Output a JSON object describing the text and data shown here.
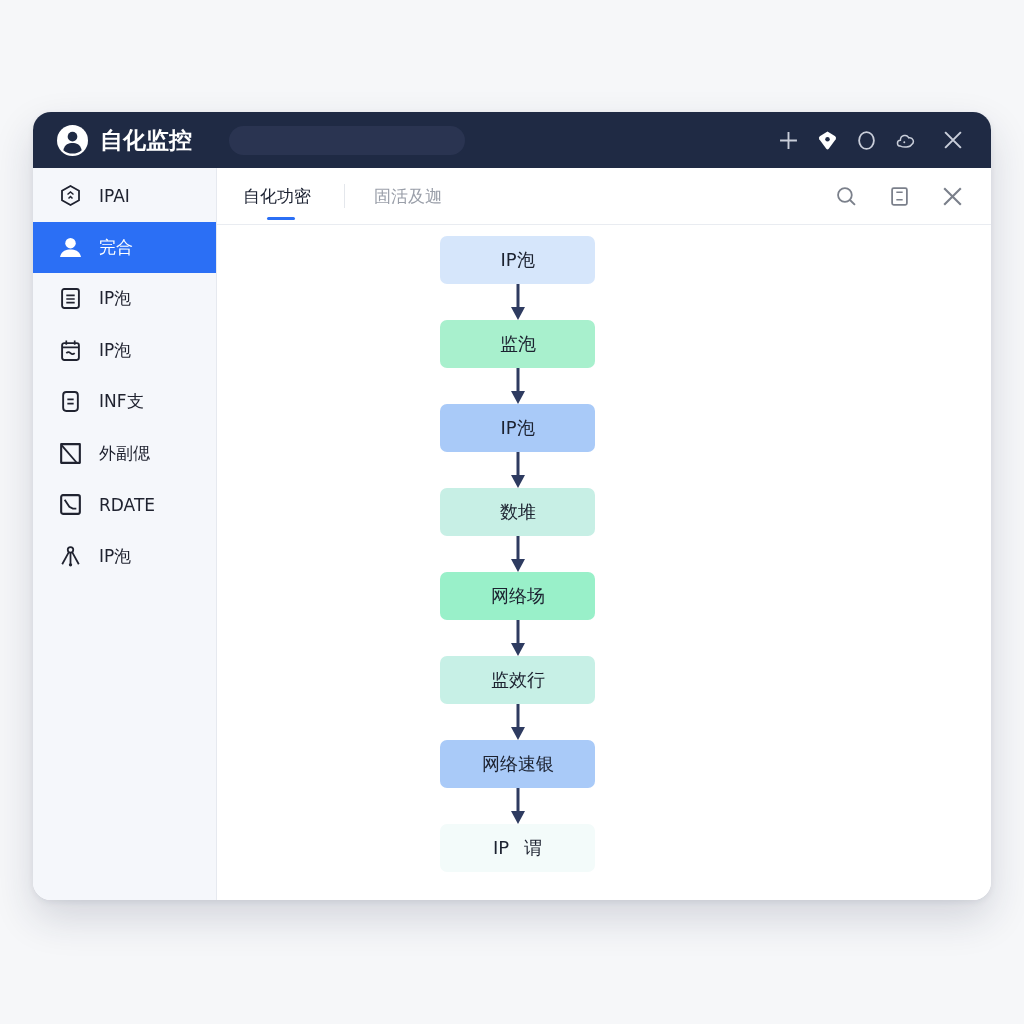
{
  "window": {
    "title": "自化监控"
  },
  "sidebar": {
    "items": [
      {
        "label": "IPAI",
        "selected": false
      },
      {
        "label": "完合",
        "selected": true
      },
      {
        "label": "IP泡",
        "selected": false
      },
      {
        "label": "IP泡",
        "selected": false
      },
      {
        "label": "INF支",
        "selected": false
      },
      {
        "label": "外副偲",
        "selected": false
      },
      {
        "label": "RDATE",
        "selected": false
      },
      {
        "label": "IP泡",
        "selected": false
      }
    ]
  },
  "tabs": [
    {
      "label": "自化功密",
      "selected": true
    },
    {
      "label": "固活及迦",
      "selected": false
    }
  ],
  "flow": {
    "nodes": [
      {
        "label": "IP泡",
        "color": "#d6e6fb"
      },
      {
        "label": "监泡",
        "color": "#a8f0cd"
      },
      {
        "label": "IP泡",
        "color": "#a9caf8"
      },
      {
        "label": "数堆",
        "color": "#c7efe5"
      },
      {
        "label": "网络场",
        "color": "#99f0c9"
      },
      {
        "label": "监效行",
        "color": "#c7f0e6"
      },
      {
        "label": "网络速银",
        "color": "#a9caf8"
      },
      {
        "label": "IP 谓",
        "color": "#f3fbfa"
      }
    ]
  }
}
